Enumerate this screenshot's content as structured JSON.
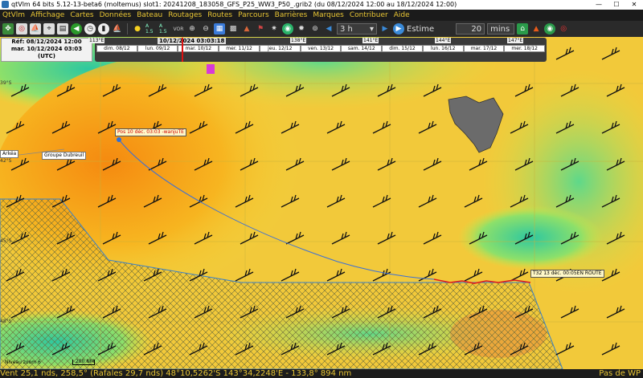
{
  "window": {
    "title": "qtVlm 64 bits 5.12-13-beta6 (moltemus) slot1: 20241208_183058_GFS_P25_WW3_P50_.grib2 (du 08/12/2024 12:00 au 18/12/2024 12:00)",
    "controls": [
      "—",
      "☐",
      "✕"
    ]
  },
  "menu": [
    "QtVlm",
    "Affichage",
    "Cartes",
    "Données",
    "Bateau",
    "Routages",
    "Routes",
    "Parcours",
    "Barrières",
    "Marques",
    "Contribuer",
    "Aide"
  ],
  "toolbar": {
    "step": "3 h",
    "mode": "Estime",
    "duration": "20",
    "unit": "mins",
    "icon_labels": [
      "A 1.5",
      "A 1.5",
      "VOR"
    ]
  },
  "colors": {
    "menu_text": "#e8c534",
    "route": "#3a6fd8",
    "route_alt": "#e11a1a",
    "barrier": "#3a80c8"
  },
  "reference": {
    "line1": "Réf: 08/12/2024 12:00",
    "line2": "mar. 10/12/2024 03:03",
    "line3": "(UTC)"
  },
  "timeline": {
    "current": "10/12/2024 03:03:18",
    "days": [
      "dim. 08/12",
      "lun. 09/12",
      "mar. 10/12",
      "mer. 11/12",
      "jeu. 12/12",
      "ven. 13/12",
      "sam. 14/12",
      "dim. 15/12",
      "lun. 16/12",
      "mar. 17/12",
      "mer. 18/12"
    ],
    "lon_labels": [
      "113°E",
      "138°E",
      "141°E",
      "144°E",
      "147°E"
    ]
  },
  "map_labels": {
    "route_start": "Pos 10 déc. 03:03 -wanjuTE",
    "route_end": "T32 13 déc. 00:05EN ROUTE",
    "boat_group": "Groupe Dubreuil",
    "boat_arkea": "Arkéa",
    "zoom": "Niveau zoom 6",
    "scale": "200 NM",
    "lat_labels": [
      "39°S",
      "42°S",
      "45°S",
      "48°S"
    ]
  },
  "status": {
    "text": "Vent 25,1 nds, 258,5° (Rafales 29,7 nds) 48°10,5262'S 143°34,2248'E - 133,8° 894 nm",
    "right": "Pas de WP"
  }
}
